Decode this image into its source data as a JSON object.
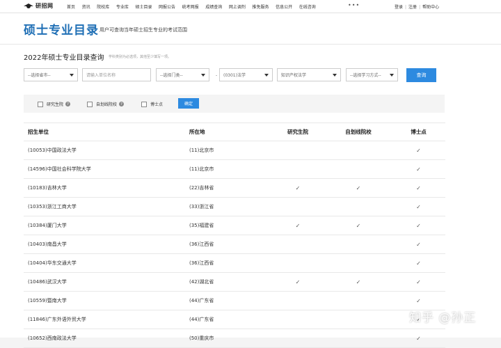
{
  "topnav": {
    "logo_text": "研招网",
    "links": [
      "首页",
      "资讯",
      "院校库",
      "专业库",
      "硕士目录",
      "网报公告",
      "统考网报",
      "成绩查询",
      "网上调剂",
      "推免服务",
      "信息公开",
      "在线咨询"
    ],
    "more": "•••",
    "login": "登录",
    "register": "注册",
    "help": "帮助中心"
  },
  "header": {
    "title": "硕士专业目录",
    "subtitle": "用户可查询当年硕士招生专业的考试范围"
  },
  "query": {
    "title": "2022年硕士专业目录查询",
    "hint": "学科类别为必选项，其他至少填写一项。",
    "province": "--选择省市--",
    "school_placeholder": "请输入单位名称",
    "category": "--选择门类--",
    "dash": "-",
    "discipline": "(0301)法学",
    "major": "知识产权法学",
    "study_mode": "--选择学习方式--",
    "search_button": "查询",
    "filters": {
      "graduate_school": "研究生院",
      "self_line": "自划线院校",
      "doctoral": "博士点",
      "confirm": "确定"
    }
  },
  "table": {
    "headers": [
      "招生单位",
      "所在地",
      "研究生院",
      "自划线院校",
      "博士点"
    ],
    "check_glyph": "✓",
    "rows": [
      {
        "unit": "(10053)中国政法大学",
        "location": "(11)北京市",
        "grad": false,
        "self": false,
        "phd": true
      },
      {
        "unit": "(14596)中国社会科学院大学",
        "location": "(11)北京市",
        "grad": false,
        "self": false,
        "phd": true
      },
      {
        "unit": "(10183)吉林大学",
        "location": "(22)吉林省",
        "grad": true,
        "self": true,
        "phd": true
      },
      {
        "unit": "(10353)浙江工商大学",
        "location": "(33)浙江省",
        "grad": false,
        "self": false,
        "phd": true
      },
      {
        "unit": "(10384)厦门大学",
        "location": "(35)福建省",
        "grad": true,
        "self": true,
        "phd": true
      },
      {
        "unit": "(10403)南昌大学",
        "location": "(36)江西省",
        "grad": false,
        "self": false,
        "phd": true
      },
      {
        "unit": "(10404)华东交通大学",
        "location": "(36)江西省",
        "grad": false,
        "self": false,
        "phd": true
      },
      {
        "unit": "(10486)武汉大学",
        "location": "(42)湖北省",
        "grad": true,
        "self": true,
        "phd": true
      },
      {
        "unit": "(10559)暨南大学",
        "location": "(44)广东省",
        "grad": false,
        "self": false,
        "phd": true
      },
      {
        "unit": "(11846)广东外语外贸大学",
        "location": "(44)广东省",
        "grad": false,
        "self": false,
        "phd": true
      },
      {
        "unit": "(10652)西南政法大学",
        "location": "(50)重庆市",
        "grad": false,
        "self": false,
        "phd": true
      }
    ]
  },
  "watermark": "知乎 @孙正",
  "colors": {
    "accent": "#2d8ae0",
    "title": "#1f6fb5"
  }
}
